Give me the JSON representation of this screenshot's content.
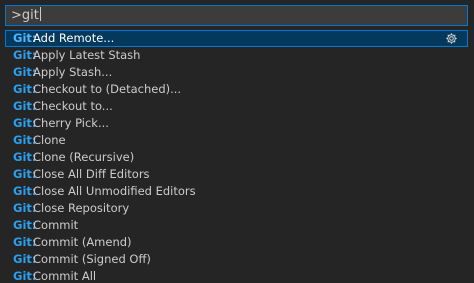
{
  "search": {
    "value": ">git"
  },
  "prefix": "Git:",
  "items": [
    {
      "label": "Add Remote...",
      "selected": true
    },
    {
      "label": "Apply Latest Stash"
    },
    {
      "label": "Apply Stash..."
    },
    {
      "label": "Checkout to (Detached)..."
    },
    {
      "label": "Checkout to..."
    },
    {
      "label": "Cherry Pick..."
    },
    {
      "label": "Clone"
    },
    {
      "label": "Clone (Recursive)"
    },
    {
      "label": "Close All Diff Editors"
    },
    {
      "label": "Close All Unmodified Editors"
    },
    {
      "label": "Close Repository"
    },
    {
      "label": "Commit"
    },
    {
      "label": "Commit (Amend)"
    },
    {
      "label": "Commit (Signed Off)"
    },
    {
      "label": "Commit All"
    }
  ],
  "icons": {
    "configure": "gear-icon"
  },
  "colors": {
    "accent": "#0078d4",
    "prefix": "#2aa0f0",
    "selection": "#04395e"
  }
}
